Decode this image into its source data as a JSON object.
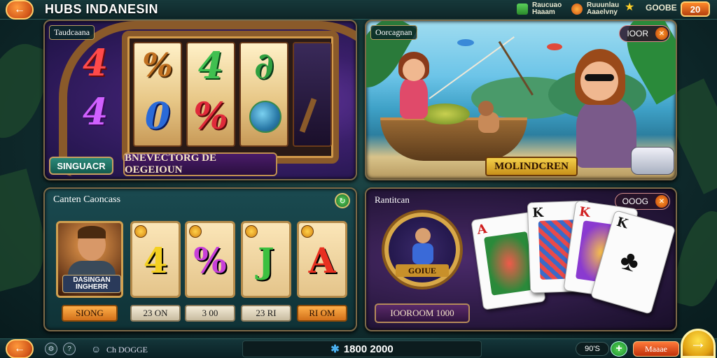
{
  "header": {
    "back_icon": "arrow-left-icon",
    "title": "HUBS INDANESIN",
    "stat1": "Raucuao\nHaaam",
    "stat2": "Ruuunlau\nAaaelvny",
    "stat3": "GOOBE",
    "level": "20"
  },
  "slot_panel": {
    "tag": "Taudcaana",
    "left_symbols": [
      "4",
      "4"
    ],
    "reels": [
      {
        "top": "%",
        "bottom": "0"
      },
      {
        "top": "4",
        "bottom": "%"
      },
      {
        "top": "∂",
        "bottom": ""
      }
    ],
    "banner": "BNEVECTORG DE OEGEIOUN",
    "button": "SINGUACR"
  },
  "fishing_panel": {
    "tag": "Oorcagnan",
    "top_pill": "IOOR",
    "top_pill_icon": "close-icon",
    "title": "MOLINDCREN"
  },
  "characters_panel": {
    "tag": "Canten Caoncass",
    "corner_icon": "refresh-icon",
    "hero_label": "DASINGAN INGHERR",
    "hero_button": "SIONG",
    "cards": [
      {
        "symbol": "4",
        "color": "#f4d020",
        "price": "23 ON"
      },
      {
        "symbol": "%",
        "color": "#c840d8",
        "price": "3 00"
      },
      {
        "symbol": "J",
        "color": "#3cc040",
        "price": "23 RI"
      },
      {
        "symbol": "A",
        "color": "#e83020",
        "price": "RI OM"
      }
    ]
  },
  "cards_panel": {
    "tag": "Rantitcan",
    "top_pill": "OOOG",
    "emblem_label": "GOIUE",
    "button": "IOOROOM 1000",
    "cards": [
      "A",
      "K",
      "K",
      "K"
    ]
  },
  "footer": {
    "back_icon": "arrow-left-icon",
    "label": "Ch DOGGE",
    "balance_prefix": "1",
    "balance": "1800 2000",
    "coins": "90'S",
    "plus": "+",
    "mega": "Maaae",
    "go_icon": "arrow-right-icon"
  }
}
